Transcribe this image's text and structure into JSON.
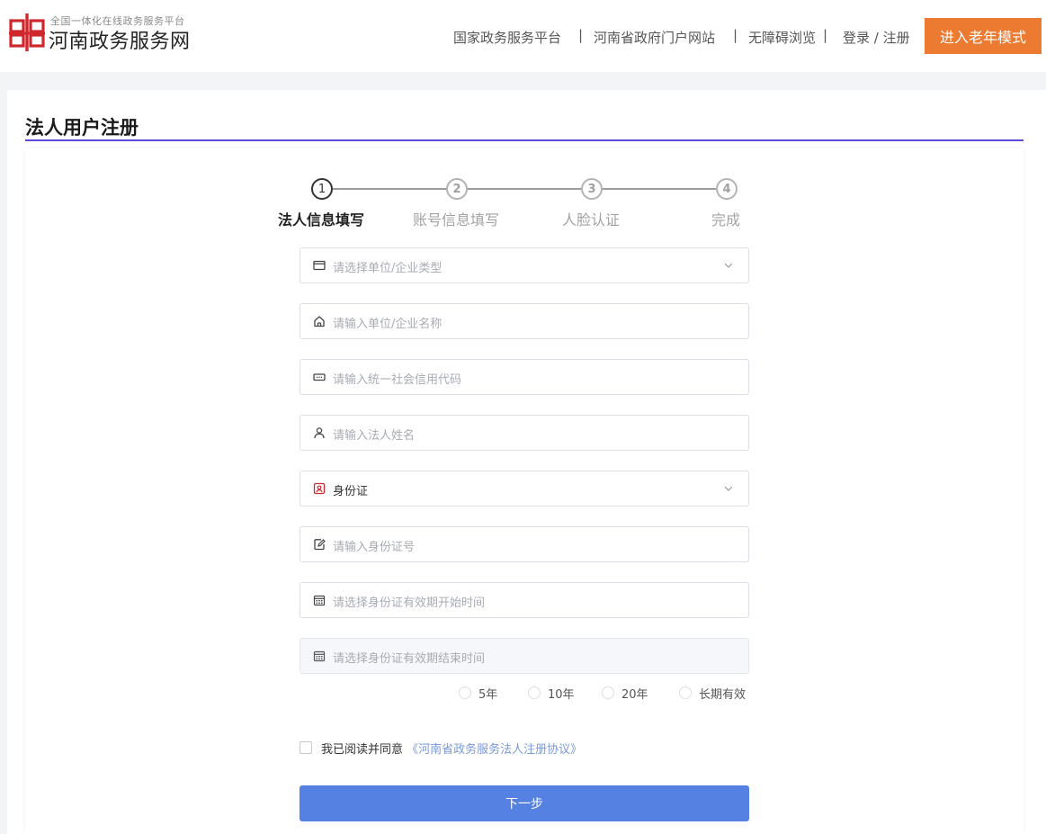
{
  "brand": {
    "subtitle": "全国一体化在线政务服务平台",
    "title": "河南政务服务网",
    "logo_icon": "henan-logo-icon",
    "logo_color": "#d0272d"
  },
  "topnav": {
    "items": [
      "国家政务服务平台",
      "河南省政府门户网站",
      "无障碍浏览",
      "登录 / 注册"
    ],
    "separator": "|",
    "elder_mode": "进入老年模式",
    "elder_color": "#ec7b31"
  },
  "page": {
    "title": "法人用户注册",
    "accent_color": "#5b4bd6"
  },
  "steps": [
    {
      "num": "1",
      "label": "法人信息填写",
      "active": true
    },
    {
      "num": "2",
      "label": "账号信息填写",
      "active": false
    },
    {
      "num": "3",
      "label": "人脸认证",
      "active": false
    },
    {
      "num": "4",
      "label": "完成",
      "active": false
    }
  ],
  "form": {
    "unit_type": {
      "placeholder": "请选择单位/企业类型",
      "icon": "id-card-icon"
    },
    "unit_name": {
      "placeholder": "请输入单位/企业名称",
      "icon": "home-icon"
    },
    "credit_code": {
      "placeholder": "请输入统一社会信用代码",
      "icon": "keyboard-icon"
    },
    "legal_name": {
      "placeholder": "请输入法人姓名",
      "icon": "user-icon"
    },
    "id_type": {
      "value": "身份证",
      "icon": "id-badge-icon"
    },
    "id_number": {
      "placeholder": "请输入身份证号",
      "icon": "edit-icon"
    },
    "id_start": {
      "placeholder": "请选择身份证有效期开始时间",
      "icon": "calendar-icon"
    },
    "id_end": {
      "placeholder": "请选择身份证有效期结束时间",
      "icon": "calendar-icon"
    },
    "validity_options": [
      "5年",
      "10年",
      "20年",
      "长期有效"
    ]
  },
  "agreement": {
    "text": "我已阅读并同意",
    "link": "《河南省政务服务法人注册协议》",
    "link_color": "#7a98d8"
  },
  "next_button": {
    "label": "下一步",
    "color": "#5581e3"
  }
}
